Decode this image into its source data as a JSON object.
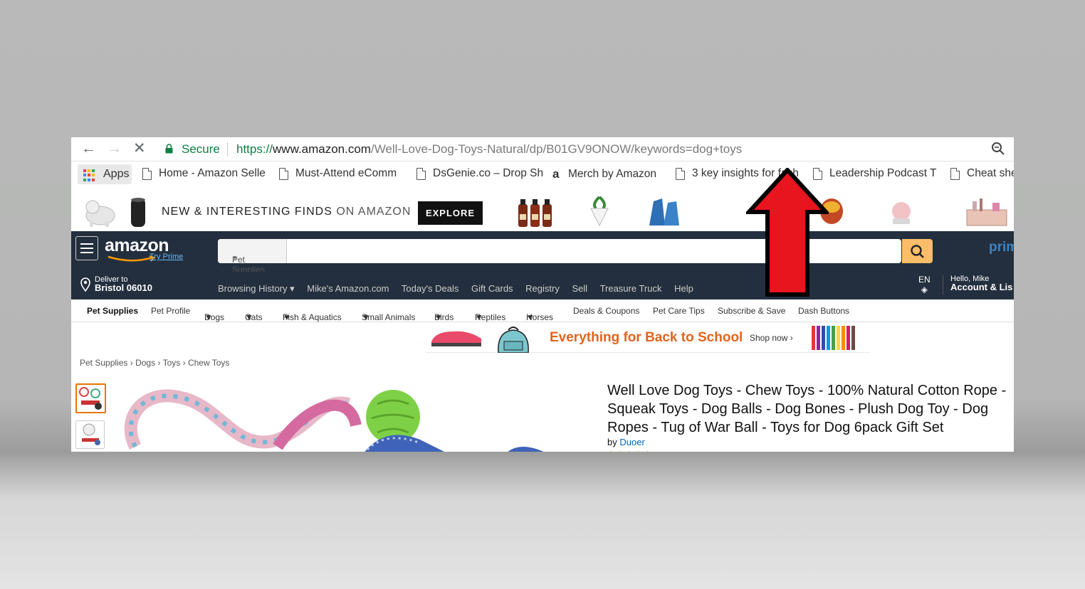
{
  "browser": {
    "secure_label": "Secure",
    "url_scheme": "https://",
    "url_host": "www.amazon.com",
    "url_path": "/Well-Love-Dog-Toys-Natural/dp/B01GV9ONOW/keywords=dog+toys"
  },
  "bookmarks": {
    "apps_label": "Apps",
    "items": [
      "Home - Amazon Selle",
      "Must-Attend eComm",
      "DsGenie.co – Drop Sh",
      "Merch by Amazon",
      "3 key insights for fash",
      "Leadership Podcast T",
      "Cheat she"
    ]
  },
  "promo": {
    "text_bold": "NEW & INTERESTING FINDS",
    "text_light": "ON AMAZON",
    "explore_label": "EXPLORE"
  },
  "header": {
    "logo": "amazon",
    "try_prime": "Try Prime",
    "search_category": "Pet Supplies",
    "prime_logo": "prim"
  },
  "nav": {
    "deliver_to": "Deliver to",
    "location": "Bristol 06010",
    "links": [
      "Browsing History ▾",
      "Mike's Amazon.com",
      "Today's Deals",
      "Gift Cards",
      "Registry",
      "Sell",
      "Treasure Truck",
      "Help"
    ],
    "language": "EN",
    "greeting": "Hello, Mike",
    "account": "Account & Lis"
  },
  "subnav": {
    "items": [
      "Pet Supplies",
      "Pet Profile",
      "Dogs",
      "Cats",
      "Fish & Aquatics",
      "Small Animals",
      "Birds",
      "Reptiles",
      "Horses",
      "Deals & Coupons",
      "Pet Care Tips",
      "Subscribe & Save",
      "Dash Buttons"
    ]
  },
  "banner": {
    "text": "Everything for Back to School",
    "shop_now": "Shop now ›"
  },
  "breadcrumb": {
    "items": [
      "Pet Supplies",
      "Dogs",
      "Toys",
      "Chew Toys"
    ]
  },
  "product": {
    "title": "Well Love Dog Toys - Chew Toys - 100% Natural Cotton Rope - Squeak Toys - Dog Balls - Dog Bones - Plush Dog Toy - Dog Ropes - Tug of War Ball - Toys for Dog 6pack Gift Set",
    "by_label": "by",
    "brand": "Duoer"
  }
}
